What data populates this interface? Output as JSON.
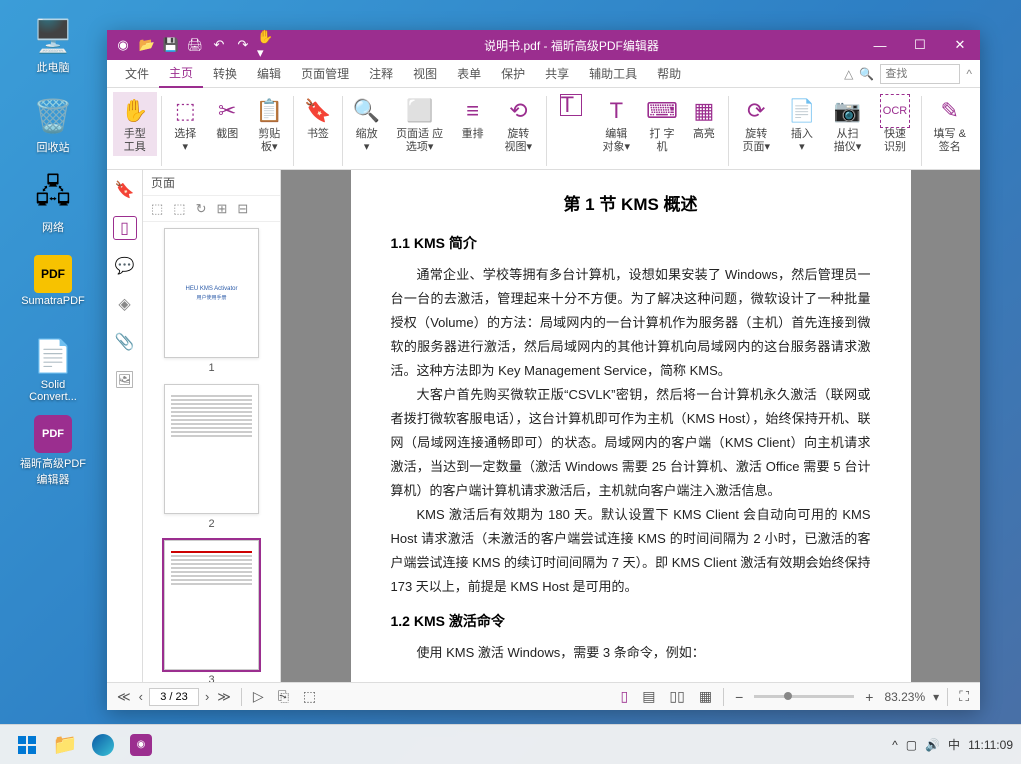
{
  "desktop": {
    "icons": [
      {
        "label": "此电脑"
      },
      {
        "label": "回收站"
      },
      {
        "label": "网络"
      },
      {
        "label": "SumatraPDF"
      },
      {
        "label": "Solid Convert..."
      },
      {
        "label": "福昕高级PDF编辑器"
      }
    ]
  },
  "window": {
    "title": "说明书.pdf - 福昕高级PDF编辑器",
    "tabs": [
      "文件",
      "主页",
      "转换",
      "编辑",
      "页面管理",
      "注释",
      "视图",
      "表单",
      "保护",
      "共享",
      "辅助工具",
      "帮助"
    ],
    "active_tab": 1,
    "search_placeholder": "查找",
    "ribbon": [
      {
        "label": "手型\n工具",
        "icon": "✋"
      },
      {
        "label": "选择\n▾",
        "icon": "⬚"
      },
      {
        "label": "截图",
        "icon": "✂"
      },
      {
        "label": "剪贴\n板▾",
        "icon": "📋"
      },
      {
        "label": "书签",
        "icon": "🔖"
      },
      {
        "label": "缩放\n▾",
        "icon": "🔍"
      },
      {
        "label": "页面适\n应选项▾",
        "icon": "⬜"
      },
      {
        "label": "重排",
        "icon": "≡"
      },
      {
        "label": "旋转\n视图▾",
        "icon": "⟲"
      },
      {
        "label": "",
        "icon": "T"
      },
      {
        "label": "编辑\n对象▾",
        "icon": "T"
      },
      {
        "label": "打\n字机",
        "icon": "⌨"
      },
      {
        "label": "高亮",
        "icon": "▦"
      },
      {
        "label": "旋转\n页面▾",
        "icon": "⟳"
      },
      {
        "label": "插入\n▾",
        "icon": "📄"
      },
      {
        "label": "从扫\n描仪▾",
        "icon": "📷"
      },
      {
        "label": "快速\n识别",
        "icon": "OCR"
      },
      {
        "label": "填写\n&签名",
        "icon": "✎"
      }
    ],
    "thumbpanel_title": "页面",
    "page_input": "3 / 23",
    "total_pages": "23",
    "zoom": "83.23%",
    "thumbs": [
      "1",
      "2",
      "3"
    ]
  },
  "document": {
    "h2": "第 1 节 KMS 概述",
    "h3a": "1.1 KMS 简介",
    "p1": "通常企业、学校等拥有多台计算机，设想如果安装了 Windows，然后管理员一台一台的去激活，管理起来十分不方便。为了解决这种问题，微软设计了一种批量授权（Volume）的方法：局域网内的一台计算机作为服务器（主机）首先连接到微软的服务器进行激活，然后局域网内的其他计算机向局域网内的这台服务器请求激活。这种方法即为 Key Management Service，简称 KMS。",
    "p2": "大客户首先购买微软正版“CSVLK”密钥，然后将一台计算机永久激活（联网或者拨打微软客服电话），这台计算机即可作为主机（KMS Host），始终保持开机、联网（局域网连接通畅即可）的状态。局域网内的客户端（KMS Client）向主机请求激活，当达到一定数量（激活 Windows 需要 25 台计算机、激活 Office 需要 5 台计算机）的客户端计算机请求激活后，主机就向客户端注入激活信息。",
    "p3": "KMS 激活后有效期为 180 天。默认设置下 KMS Client 会自动向可用的 KMS Host 请求激活（未激活的客户端尝试连接 KMS 的时间间隔为 2 小时，已激活的客户端尝试连接 KMS 的续订时间间隔为 7 天）。即 KMS Client 激活有效期会始终保持 173 天以上，前提是 KMS Host 是可用的。",
    "h3b": "1.2 KMS 激活命令",
    "p4": "使用 KMS 激活 Windows，需要 3 条命令，例如："
  },
  "taskbar": {
    "ime": "中",
    "clock": "11:11:09"
  }
}
